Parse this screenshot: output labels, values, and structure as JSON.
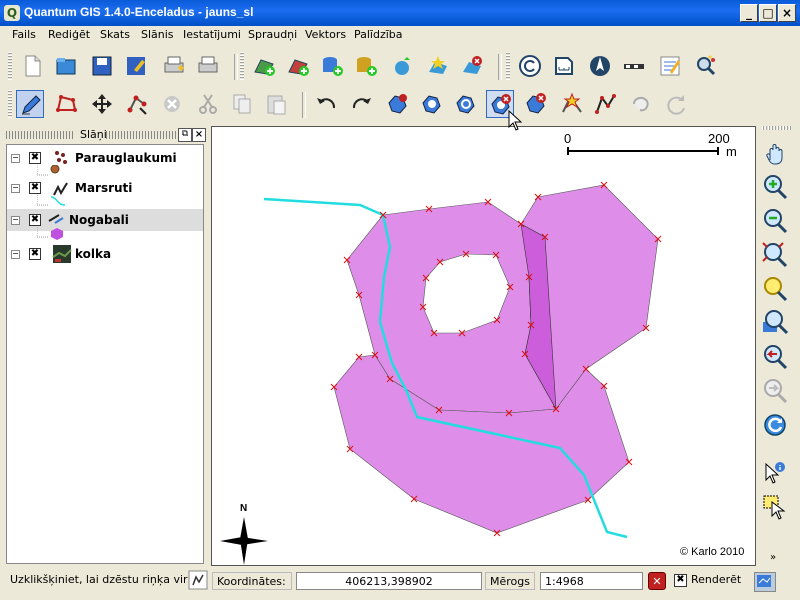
{
  "window": {
    "title": "Quantum GIS 1.4.0-Enceladus - jauns_sl",
    "app_icon": "Q",
    "buttons": [
      "minimize",
      "maximize",
      "close"
    ]
  },
  "menu": [
    "Fails",
    "Rediģēt",
    "Skats",
    "Slānis",
    "Iestatījumi",
    "Spraudņi",
    "Vektors",
    "Palīdzība"
  ],
  "layers_panel": {
    "title": "Slāņi",
    "layers": [
      {
        "name": "Parauglaukumi",
        "checked": true,
        "icon": "point-layer-icon",
        "selected": false
      },
      {
        "name": "Marsruti",
        "checked": true,
        "icon": "line-layer-icon",
        "selected": false
      },
      {
        "name": "Nogabali",
        "checked": true,
        "icon": "polygon-layer-icon",
        "selected": true
      },
      {
        "name": "kolka",
        "checked": true,
        "icon": "raster-layer-icon",
        "selected": false
      }
    ]
  },
  "map": {
    "scalebar": {
      "start": "0",
      "end": "200",
      "unit": "m"
    },
    "north_arrow": "N",
    "copyright": "© Karlo 2010",
    "colors": {
      "polygon_fill": "#de8ee9",
      "selected_fill": "#cc5edb",
      "route": "#22dde0",
      "vertex": "#d81010"
    }
  },
  "statusbar": {
    "message": "Uzklikšķiniet, lai dzēstu riņķa virsotni",
    "coords_label": "Koordinātes:",
    "coords_value": "406213,398902",
    "scale_label": "Mērogs",
    "scale_value": "1:4968",
    "render_label": "Renderēt",
    "render_checked": true
  }
}
